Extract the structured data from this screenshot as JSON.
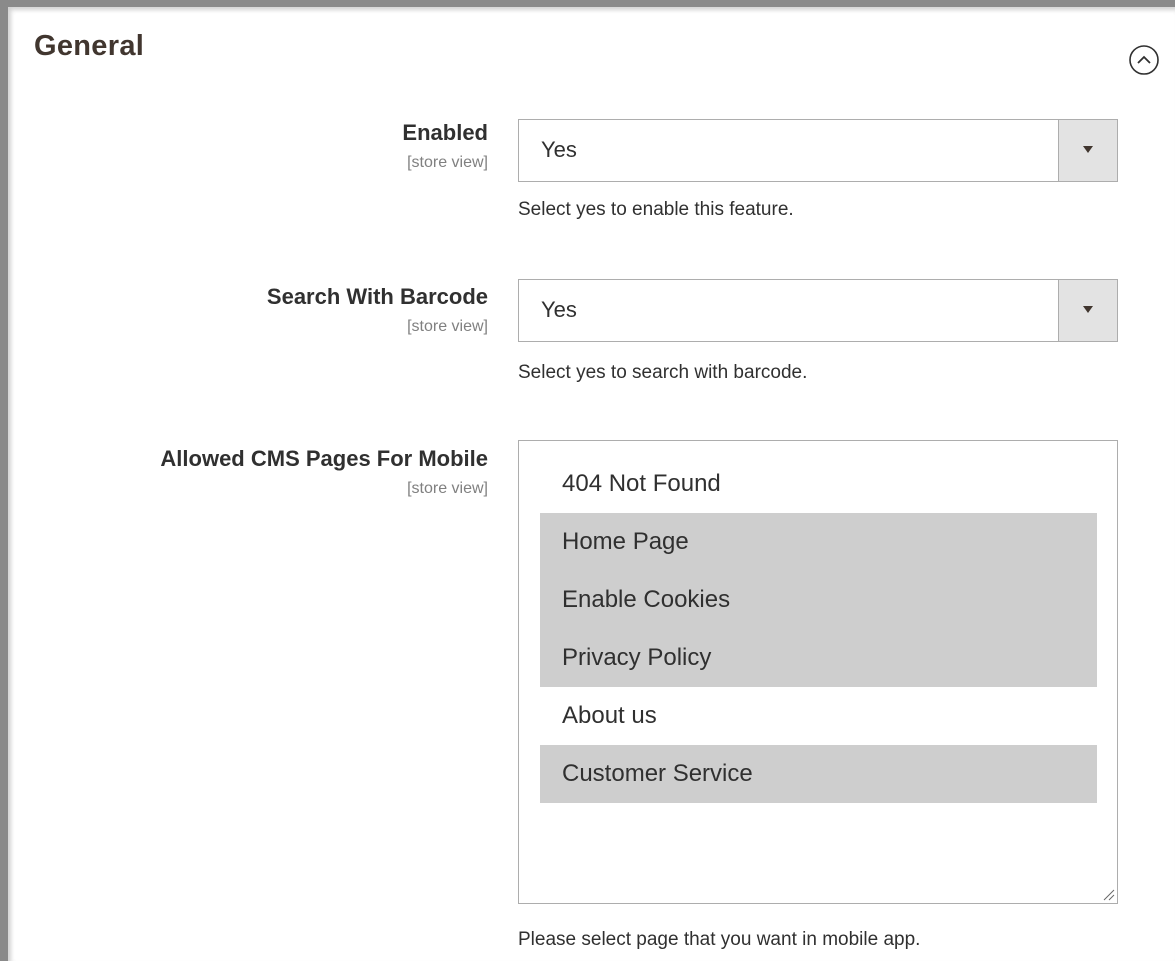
{
  "section": {
    "title": "General"
  },
  "fields": {
    "enabled": {
      "label": "Enabled",
      "scope": "[store view]",
      "value": "Yes",
      "note": "Select yes to enable this feature."
    },
    "search_barcode": {
      "label": "Search With Barcode",
      "scope": "[store view]",
      "value": "Yes",
      "note": "Select yes to search with barcode."
    },
    "cms_pages": {
      "label": "Allowed CMS Pages For Mobile",
      "scope": "[store view]",
      "options": [
        {
          "label": "404 Not Found",
          "selected": false
        },
        {
          "label": "Home Page",
          "selected": true
        },
        {
          "label": "Enable Cookies",
          "selected": true
        },
        {
          "label": "Privacy Policy",
          "selected": true
        },
        {
          "label": "About us",
          "selected": false
        },
        {
          "label": "Customer Service",
          "selected": true
        }
      ],
      "note": "Please select page that you want in mobile app."
    }
  },
  "icons": {
    "collapse": "chevron-up-circle-icon",
    "dropdown": "caret-down-icon",
    "resize": "resize-grip-icon"
  },
  "colors": {
    "selected_option_bg": "#cecece",
    "arrow_box_bg": "#e3e3e3",
    "border": "#adadad",
    "title": "#41362f"
  }
}
